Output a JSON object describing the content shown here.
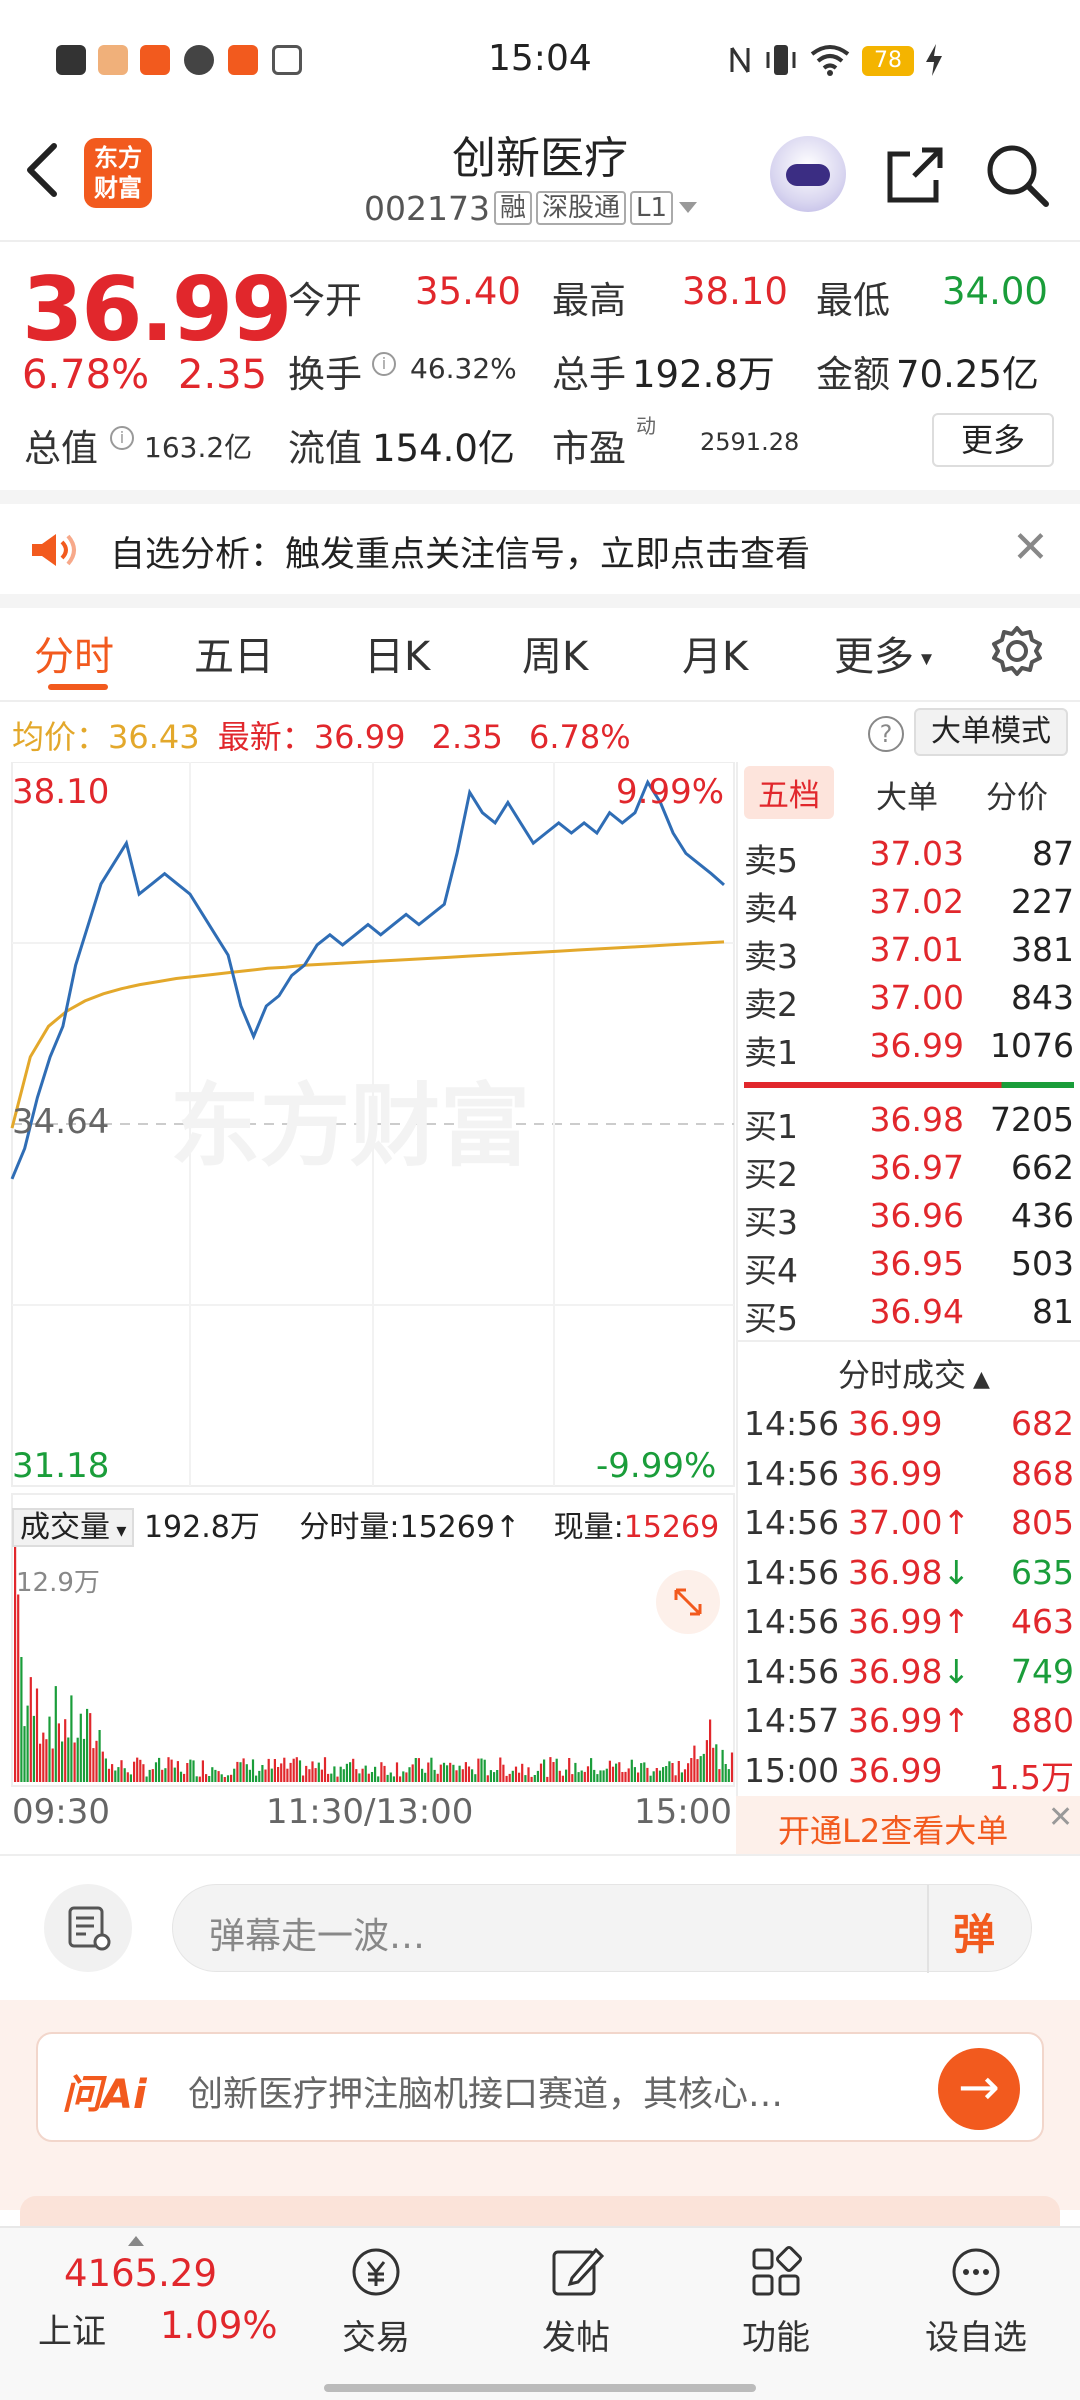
{
  "status": {
    "time": "15:04",
    "battery": "78"
  },
  "header": {
    "logo_line1": "东方",
    "logo_line2": "财富",
    "name": "创新医疗",
    "code": "002173",
    "tags": [
      "融",
      "深股通",
      "L1"
    ]
  },
  "quote": {
    "price": "36.99",
    "pct": "6.78%",
    "chg": "2.35",
    "open_label": "今开",
    "open": "35.40",
    "high_label": "最高",
    "high": "38.10",
    "low_label": "最低",
    "low": "34.00",
    "turnover_label": "换手",
    "turnover": "46.32%",
    "volume_label": "总手",
    "volume": "192.8万",
    "amount_label": "金额",
    "amount": "70.25亿",
    "mktcap_label": "总值",
    "mktcap": "163.2亿",
    "float_label": "流值",
    "float": "154.0亿",
    "pe_label": "市盈",
    "pe_sup": "动",
    "pe": "2591.28",
    "more": "更多"
  },
  "alert": {
    "text": "自选分析：触发重点关注信号，立即点击查看"
  },
  "tabs": [
    "分时",
    "五日",
    "日K",
    "周K",
    "月K",
    "更多"
  ],
  "avg_row": {
    "avg_label": "均价：",
    "avg": "36.43",
    "latest_label": "最新：",
    "latest": "36.99",
    "chg": "2.35",
    "pct": "6.78%",
    "mode_button": "大单模式"
  },
  "chart": {
    "ymax_label": "38.10",
    "ymin_label": "31.18",
    "pct_top": "9.99%",
    "pct_bottom": "-9.99%",
    "ref_label": "34.64",
    "watermark": "东方财富",
    "vol_selector": "成交量",
    "vol_total": "192.8万",
    "vol_tick_label": "分时量:",
    "vol_tick": "15269",
    "vol_now_label": "现量:",
    "vol_now": "15269",
    "vol_max_label": "12.9万",
    "x_labels": [
      "09:30",
      "11:30/13:00",
      "15:00"
    ]
  },
  "chart_data": {
    "type": "line",
    "title": "",
    "ylim": [
      31.18,
      38.1
    ],
    "reference": 34.64,
    "series": [
      {
        "name": "",
        "values": [
          34.1,
          34.4,
          34.9,
          35.3,
          35.6,
          36.2,
          36.6,
          37.0,
          37.2,
          37.4,
          36.9,
          37.0,
          37.1,
          37.0,
          36.9,
          36.7,
          36.5,
          36.3,
          35.8,
          35.5,
          35.8,
          35.9,
          36.1,
          36.2,
          36.4,
          36.5,
          36.4,
          36.5,
          36.6,
          36.5,
          36.6,
          36.7,
          36.6,
          36.7,
          36.8,
          37.3,
          37.9,
          37.7,
          37.6,
          37.8,
          37.6,
          37.4,
          37.5,
          37.6,
          37.5,
          37.6,
          37.5,
          37.7,
          37.6,
          37.7,
          38.0,
          37.8,
          37.5,
          37.3,
          37.2,
          37.1,
          36.99
        ]
      },
      {
        "name": "",
        "values": [
          34.6,
          35.3,
          35.6,
          35.75,
          35.85,
          35.92,
          35.97,
          36.01,
          36.04,
          36.07,
          36.09,
          36.11,
          36.13,
          36.15,
          36.17,
          36.18,
          36.2,
          36.21,
          36.22,
          36.23,
          36.24,
          36.25,
          36.26,
          36.27,
          36.28,
          36.29,
          36.3,
          36.31,
          36.32,
          36.33,
          36.34,
          36.35,
          36.36,
          36.37,
          36.38,
          36.39,
          36.4,
          36.41,
          36.42,
          36.43
        ]
      }
    ]
  },
  "orderbook": {
    "tabs": [
      "五档",
      "大单",
      "分价"
    ],
    "sells": [
      {
        "label": "卖5",
        "price": "37.03",
        "vol": "87"
      },
      {
        "label": "卖4",
        "price": "37.02",
        "vol": "227"
      },
      {
        "label": "卖3",
        "price": "37.01",
        "vol": "381"
      },
      {
        "label": "卖2",
        "price": "37.00",
        "vol": "843"
      },
      {
        "label": "卖1",
        "price": "36.99",
        "vol": "1076"
      }
    ],
    "buys": [
      {
        "label": "买1",
        "price": "36.98",
        "vol": "7205"
      },
      {
        "label": "买2",
        "price": "36.97",
        "vol": "662"
      },
      {
        "label": "买3",
        "price": "36.96",
        "vol": "436"
      },
      {
        "label": "买4",
        "price": "36.95",
        "vol": "503"
      },
      {
        "label": "买5",
        "price": "36.94",
        "vol": "81"
      }
    ],
    "ticks_title": "分时成交",
    "ticks": [
      {
        "time": "14:56",
        "price": "36.99",
        "dir": "",
        "vol": "682",
        "color": "red"
      },
      {
        "time": "14:56",
        "price": "36.99",
        "dir": "",
        "vol": "868",
        "color": "red"
      },
      {
        "time": "14:56",
        "price": "37.00",
        "dir": "↑",
        "vol": "805",
        "color": "red"
      },
      {
        "time": "14:56",
        "price": "36.98",
        "dir": "↓",
        "vol": "635",
        "color": "green"
      },
      {
        "time": "14:56",
        "price": "36.99",
        "dir": "↑",
        "vol": "463",
        "color": "red"
      },
      {
        "time": "14:56",
        "price": "36.98",
        "dir": "↓",
        "vol": "749",
        "color": "green"
      },
      {
        "time": "14:57",
        "price": "36.99",
        "dir": "↑",
        "vol": "880",
        "color": "red"
      },
      {
        "time": "15:00",
        "price": "36.99",
        "dir": "",
        "vol": "1.5万",
        "color": "red"
      }
    ],
    "l2_text": "开通L2查看大单"
  },
  "comment": {
    "placeholder": "弹幕走一波…",
    "send": "弹"
  },
  "ai": {
    "logo": "问Ai",
    "text": "创新医疗押注脑机接口赛道，其核心…"
  },
  "bottomnav": {
    "index_value": "4165.29",
    "index_name": "上证",
    "index_pct": "1.09%",
    "items": [
      "交易",
      "发帖",
      "功能",
      "设自选"
    ]
  },
  "colors": {
    "up": "#e1272c",
    "down": "#1a9d3a",
    "accent": "#f25a1e",
    "price_line": "#2f6db5",
    "avg_line": "#e3a82b"
  }
}
